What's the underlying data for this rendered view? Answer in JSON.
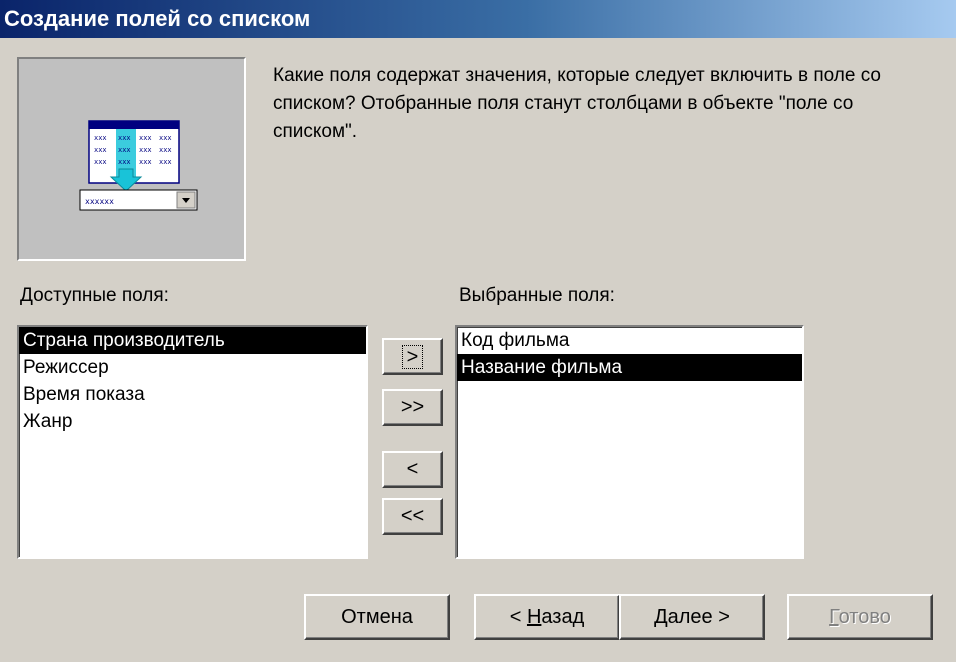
{
  "window": {
    "title": "Создание полей со списком"
  },
  "prompt": {
    "text": "Какие поля содержат значения, которые следует включить в поле со списком? Отобранные поля станут столбцами в объекте \"поле со списком\"."
  },
  "available": {
    "label": "Доступные поля:",
    "items": [
      "Страна производитель",
      "Режиссер",
      "Время показа",
      "Жанр"
    ],
    "selected_index": 0
  },
  "selected": {
    "label": "Выбранные поля:",
    "items": [
      "Код фильма",
      "Название фильма"
    ],
    "selected_index": 1
  },
  "move_buttons": {
    "add": ">",
    "add_all": ">>",
    "remove": "<",
    "remove_all": "<<"
  },
  "footer": {
    "cancel": "Отмена",
    "back_prefix": "< ",
    "back_hotkey": "Н",
    "back_rest": "азад",
    "next_hotkey": "Д",
    "next_rest": "алее >",
    "finish_hotkey": "Г",
    "finish_rest": "отово",
    "finish_enabled": false
  },
  "colors": {
    "dialog_bg": "#d4d0c8",
    "title_start": "#0a246a",
    "title_end": "#a6caf0",
    "selection_bg": "#000000",
    "selection_fg": "#ffffff",
    "disabled_text": "#808080",
    "arrow_accent": "#19c3d8"
  },
  "illustration": {
    "icon": "combo-box-wizard-icon",
    "combo_text": "xxxxxx",
    "grid_cell": "xxx"
  }
}
